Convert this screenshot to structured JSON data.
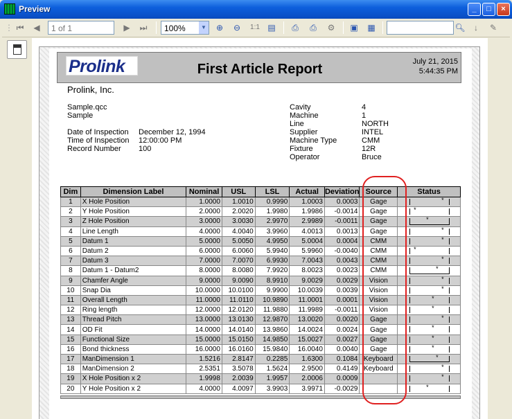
{
  "window": {
    "title": "Preview"
  },
  "toolbar": {
    "page_value": "1 of 1",
    "zoom_value": "100%",
    "search_value": ""
  },
  "report": {
    "logo_text": "Prolink",
    "title": "First Article Report",
    "date": "July 21, 2015",
    "time": "5:44:35 PM",
    "company": "Prolink, Inc."
  },
  "left_info": {
    "file": "Sample.qcc",
    "name": "Sample",
    "fields": [
      {
        "label": "Date of Inspection",
        "value": "December 12, 1994"
      },
      {
        "label": "Time of Inspection",
        "value": "12:00:00 PM"
      },
      {
        "label": "Record Number",
        "value": "100"
      }
    ]
  },
  "right_info": [
    {
      "label": "Cavity",
      "value": "4"
    },
    {
      "label": "Machine",
      "value": "1"
    },
    {
      "label": "Line",
      "value": "NORTH"
    },
    {
      "label": "Supplier",
      "value": "INTEL"
    },
    {
      "label": "Machine Type",
      "value": "CMM"
    },
    {
      "label": "Fixture",
      "value": "12R"
    },
    {
      "label": "Operator",
      "value": "Bruce"
    }
  ],
  "table": {
    "headers": [
      "Dim",
      "Dimension Label",
      "Nominal",
      "USL",
      "LSL",
      "Actual",
      "Deviation",
      "Source",
      "Status"
    ],
    "rows": [
      [
        "1",
        "X Hole Position",
        "1.0000",
        "1.0010",
        "0.9990",
        "1.0003",
        "0.0003",
        "Gage"
      ],
      [
        "2",
        "Y Hole Position",
        "2.0000",
        "2.0020",
        "1.9980",
        "1.9986",
        "-0.0014",
        "Gage"
      ],
      [
        "3",
        "Z Hole Position",
        "3.0000",
        "3.0030",
        "2.9970",
        "2.9989",
        "-0.0011",
        "Gage"
      ],
      [
        "4",
        "Line Length",
        "4.0000",
        "4.0040",
        "3.9960",
        "4.0013",
        "0.0013",
        "Gage"
      ],
      [
        "5",
        "Datum 1",
        "5.0000",
        "5.0050",
        "4.9950",
        "5.0004",
        "0.0004",
        "CMM"
      ],
      [
        "6",
        "Datum 2",
        "6.0000",
        "6.0060",
        "5.9940",
        "5.9960",
        "-0.0040",
        "CMM"
      ],
      [
        "7",
        "Datum 3",
        "7.0000",
        "7.0070",
        "6.9930",
        "7.0043",
        "0.0043",
        "CMM"
      ],
      [
        "8",
        "Datum 1 - Datum2",
        "8.0000",
        "8.0080",
        "7.9920",
        "8.0023",
        "0.0023",
        "CMM"
      ],
      [
        "9",
        "Chamfer Angle",
        "9.0000",
        "9.0090",
        "8.9910",
        "9.0029",
        "0.0029",
        "Vision"
      ],
      [
        "10",
        "Snap Dia",
        "10.0000",
        "10.0100",
        "9.9900",
        "10.0039",
        "0.0039",
        "Vision"
      ],
      [
        "11",
        "Overall Length",
        "11.0000",
        "11.0110",
        "10.9890",
        "11.0001",
        "0.0001",
        "Vision"
      ],
      [
        "12",
        "Ring length",
        "12.0000",
        "12.0120",
        "11.9880",
        "11.9989",
        "-0.0011",
        "Vision"
      ],
      [
        "13",
        "Thread Pitch",
        "13.0000",
        "13.0130",
        "12.9870",
        "13.0020",
        "0.0020",
        "Gage"
      ],
      [
        "14",
        "OD Fit",
        "14.0000",
        "14.0140",
        "13.9860",
        "14.0024",
        "0.0024",
        "Gage"
      ],
      [
        "15",
        "Functional Size",
        "15.0000",
        "15.0150",
        "14.9850",
        "15.0027",
        "0.0027",
        "Gage"
      ],
      [
        "16",
        "Bond thickness",
        "16.0000",
        "16.0160",
        "15.9840",
        "16.0040",
        "0.0040",
        "Gage"
      ],
      [
        "17",
        "ManDimension 1",
        "1.5216",
        "2.8147",
        "0.2285",
        "1.6300",
        "0.1084",
        "Keyboard"
      ],
      [
        "18",
        "ManDimension 2",
        "2.5351",
        "3.5078",
        "1.5624",
        "2.9500",
        "0.4149",
        "Keyboard"
      ],
      [
        "19",
        "X Hole Position x 2",
        "1.9998",
        "2.0039",
        "1.9957",
        "2.0006",
        "0.0009",
        ""
      ],
      [
        "20",
        "Y Hole Position x 2",
        "4.0000",
        "4.0097",
        "3.9903",
        "3.9971",
        "-0.0029",
        ""
      ]
    ]
  }
}
